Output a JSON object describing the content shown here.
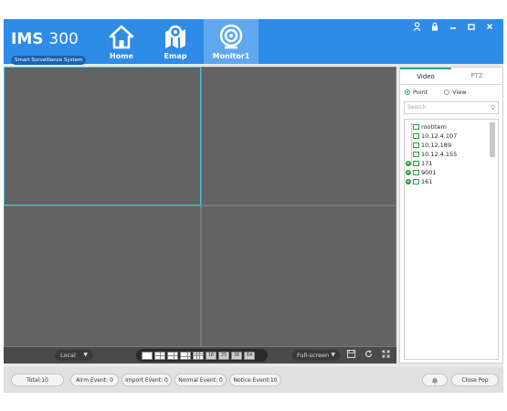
{
  "header": {
    "app_title_bold": "IMS",
    "app_title_num": "300",
    "subtitle": "Smart Surveillance System",
    "nav": [
      {
        "label": "Home",
        "icon": "home-icon"
      },
      {
        "label": "Emap",
        "icon": "map-pin-icon"
      },
      {
        "label": "Monitor1",
        "icon": "camera-icon",
        "active": true
      }
    ],
    "window_controls": [
      "user-icon",
      "lock-icon",
      "minimize-icon",
      "maximize-icon",
      "close-icon"
    ]
  },
  "video": {
    "selected_window": 1,
    "local_label": "Local",
    "fullscreen_label": "Full-screen",
    "layouts": [
      "1",
      "4",
      "6",
      "8",
      "9",
      "16",
      "25",
      "36",
      "64"
    ]
  },
  "panel": {
    "tabs": [
      {
        "label": "Video",
        "active": true
      },
      {
        "label": "PTZ",
        "active": false
      }
    ],
    "radio_point": "Point",
    "radio_view": "View",
    "search_placeholder": "Search",
    "tree": [
      {
        "label": "rootItem",
        "level": 0,
        "expandable": false
      },
      {
        "label": "10.12.4.107",
        "level": 1,
        "expandable": false
      },
      {
        "label": "10.12.189",
        "level": 1,
        "expandable": false
      },
      {
        "label": "10.12.4.155",
        "level": 1,
        "expandable": false
      },
      {
        "label": "171",
        "level": 0,
        "expandable": true
      },
      {
        "label": "9001",
        "level": 0,
        "expandable": true
      },
      {
        "label": "161",
        "level": 0,
        "expandable": true
      }
    ]
  },
  "footer": {
    "total": "Total:10",
    "alarm": "Alrm Event: 0",
    "import": "Import Event: 0",
    "normal": "Normal Event: 0",
    "notice": "Notice Event:10",
    "close_pop": "Close Pop"
  },
  "colors": {
    "header_blue": "#2e8be8",
    "selected_cell": "#4ec3d8",
    "tree_green": "#2a9d3a"
  }
}
